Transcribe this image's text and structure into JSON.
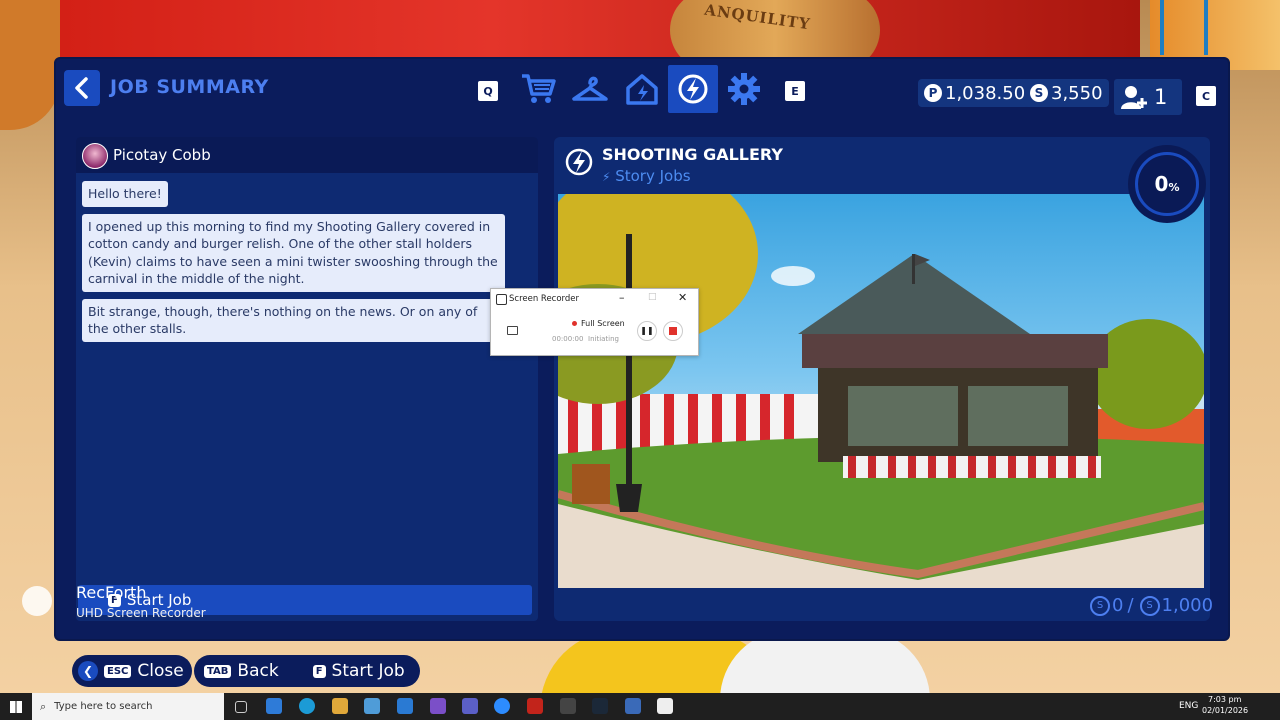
{
  "background": {
    "sign_text": "ANQUILITY"
  },
  "header": {
    "back_icon": "chevron-left-icon",
    "title": "JOB SUMMARY",
    "left_key": "Q",
    "right_key": "E",
    "tabs": [
      {
        "name": "shop",
        "icon": "cart-icon"
      },
      {
        "name": "clothing",
        "icon": "hanger-icon"
      },
      {
        "name": "home",
        "icon": "house-icon"
      },
      {
        "name": "jobs",
        "icon": "bolt-icon",
        "active": true
      },
      {
        "name": "settings",
        "icon": "gear-icon"
      }
    ],
    "currency_p": "1,038.50",
    "currency_s": "3,550",
    "player_count": "1",
    "players_key": "C"
  },
  "chat": {
    "speaker": "Picotay Cobb",
    "messages": [
      "Hello there!",
      "I opened up this morning to find my Shooting Gallery covered in cotton candy and burger relish. One of the other stall holders (Kevin) claims to have seen a mini twister swooshing through the carnival in the middle of the night.",
      "Bit strange, though, there's nothing on the news. Or on any of the other stalls."
    ],
    "start_key": "F",
    "start_label": "Start Job"
  },
  "job": {
    "title": "SHOOTING GALLERY",
    "subtitle": "Story Jobs",
    "progress": "0",
    "progress_unit": "%",
    "reward_current": "0",
    "reward_separator": "/",
    "reward_total": "1,000"
  },
  "controls": {
    "close_key": "ESC",
    "close_label": "Close",
    "back_key": "TAB",
    "back_label": "Back",
    "start_key": "F",
    "start_label": "Start Job"
  },
  "recorder": {
    "title": "Screen Recorder",
    "mode": "Full Screen",
    "time": "00:00:00",
    "status": "Initiating"
  },
  "watermark": {
    "line1": "RecForth",
    "line2": "UHD Screen Recorder"
  },
  "taskbar": {
    "search_placeholder": "Type here to search",
    "lang": "ENG",
    "time": "7:03 pm",
    "date": "02/01/2026"
  },
  "colors": {
    "panel": "#0b1c5c",
    "accent": "#1a4bbf",
    "title": "#4d7ff0"
  }
}
